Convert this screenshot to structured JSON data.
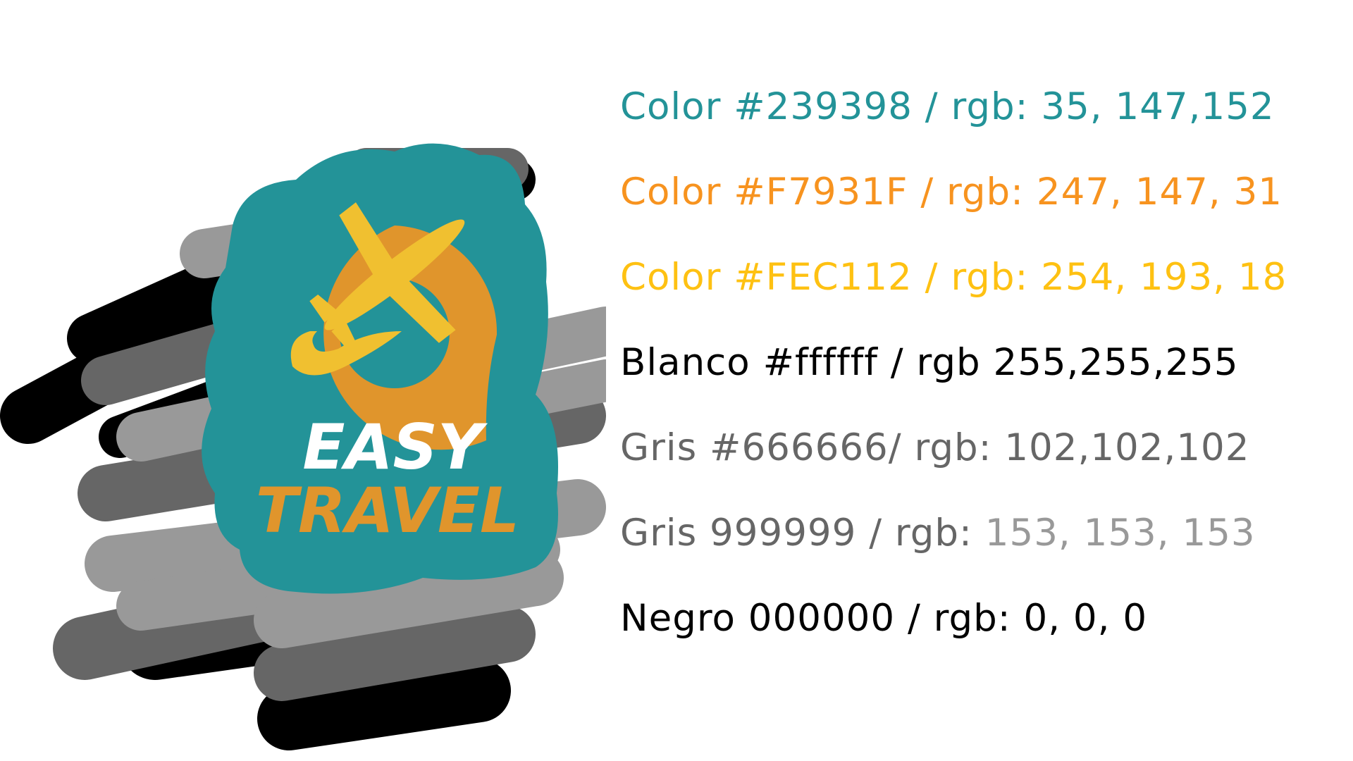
{
  "logo": {
    "word_top": "EASY",
    "word_bottom": "TRAVEL",
    "icons": [
      "map-pin-icon",
      "airplane-icon",
      "swoosh-icon"
    ]
  },
  "colors": {
    "teal": "#239398",
    "orange": "#F7931F",
    "logo_orange": "#E0952C",
    "yellow": "#FEC112",
    "logo_yellow": "#F0C030",
    "white": "#ffffff",
    "black": "#000000",
    "dark_gray": "#666666",
    "light_gray": "#999999"
  },
  "swatches": [
    {
      "text": "Color #239398 / rgb: 35, 147,152",
      "color": "#239398"
    },
    {
      "text": "Color #F7931F / rgb: 247, 147, 31",
      "color": "#F7931F"
    },
    {
      "text": "Color #FEC112 / rgb: 254, 193, 18",
      "color": "#FEC112"
    },
    {
      "text": "Blanco #ffffff / rgb 255,255,255",
      "color": "#000000"
    },
    {
      "text": "Gris #666666/ rgb: 102,102,102",
      "color": "#666666"
    },
    {
      "text": "Gris 999999 / rgb: ",
      "text_tail": "153, 153, 153",
      "color": "#666666",
      "tail_color": "#999999"
    },
    {
      "text": "Negro 000000 / rgb: 0, 0, 0",
      "color": "#000000"
    }
  ]
}
